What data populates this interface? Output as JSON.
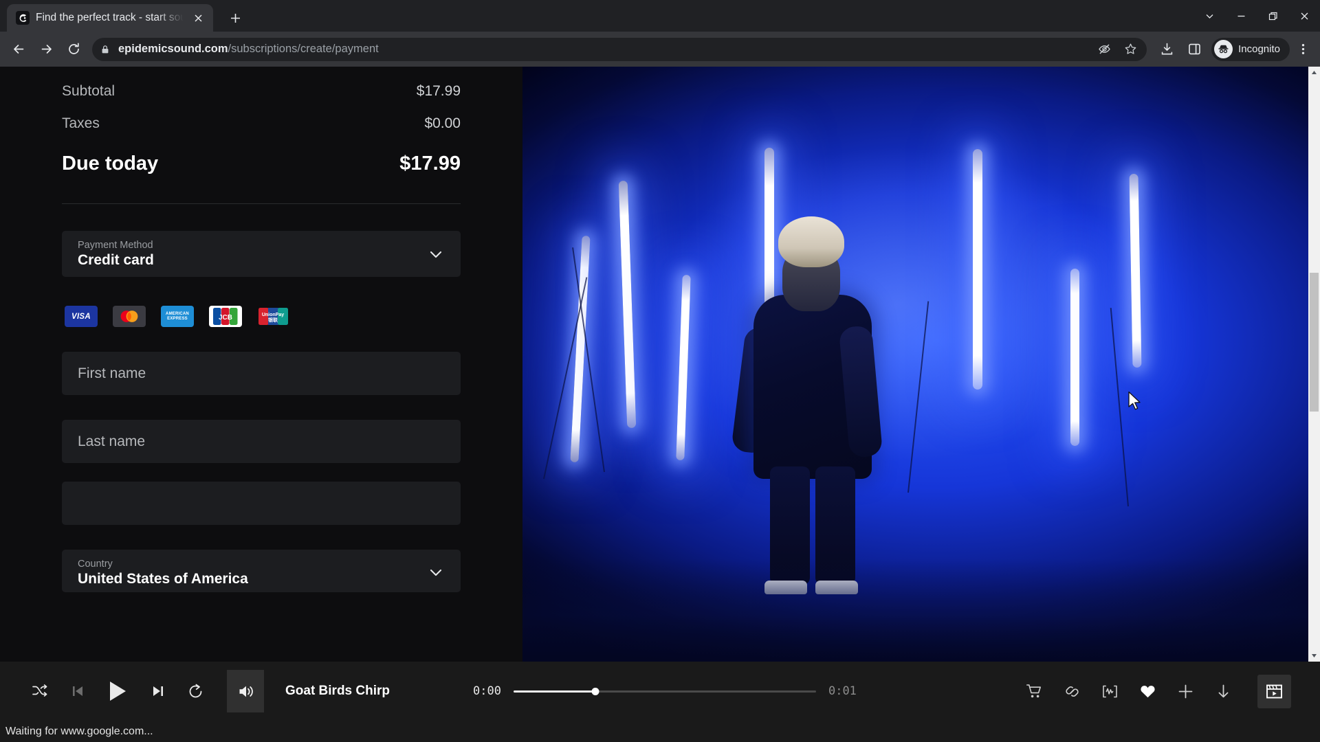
{
  "browser": {
    "tab": {
      "title": "Find the perfect track - start sou",
      "favicon_name": "epidemic-sound-favicon",
      "close_label": "✕"
    },
    "new_tab_label": "+",
    "window_controls": {
      "collapse_label": "⌄",
      "minimize_label": "—",
      "maximize_label": "❐",
      "close_label": "✕"
    },
    "toolbar": {
      "back_label": "←",
      "forward_label": "→",
      "reload_label": "↻",
      "lock_icon": "lock-icon",
      "url_domain": "epidemicsound.com",
      "url_path": "/subscriptions/create/payment",
      "tracking_protection_icon": "eye-slash-icon",
      "bookmark_icon": "star-icon",
      "download_icon": "download-icon",
      "sidepanel_icon": "side-panel-icon",
      "profile_label": "Incognito",
      "menu_icon": "three-dots-icon"
    }
  },
  "checkout": {
    "lines": [
      {
        "label": "Subtotal",
        "value": "$17.99"
      },
      {
        "label": "Taxes",
        "value": "$0.00"
      }
    ],
    "due": {
      "label": "Due today",
      "value": "$17.99"
    },
    "payment_method": {
      "label": "Payment Method",
      "value": "Credit card",
      "chevron_icon": "chevron-down-icon"
    },
    "accepted_cards": [
      {
        "name": "visa-card-icon",
        "text": "VISA"
      },
      {
        "name": "mastercard-card-icon",
        "text": ""
      },
      {
        "name": "amex-card-icon",
        "text": "AMERICAN EXPRESS"
      },
      {
        "name": "jcb-card-icon",
        "text": "JCB"
      },
      {
        "name": "unionpay-card-icon",
        "text": "UnionPay"
      }
    ],
    "fields": [
      {
        "name": "first-name-field",
        "placeholder": "First name",
        "value": ""
      },
      {
        "name": "last-name-field",
        "placeholder": "Last name",
        "value": ""
      },
      {
        "name": "address-field",
        "placeholder": "",
        "value": ""
      }
    ],
    "country": {
      "label": "Country",
      "value": "United States of America",
      "chevron_icon": "chevron-down-icon"
    }
  },
  "player": {
    "controls": {
      "shuffle_icon": "shuffle-icon",
      "previous_icon": "previous-track-icon",
      "play_icon": "play-icon",
      "next_icon": "next-track-icon",
      "repeat_icon": "repeat-icon",
      "volume_icon": "volume-icon"
    },
    "track_title": "Goat Birds Chirp",
    "time_current": "0:00",
    "time_duration": "0:01",
    "progress_percent": 27,
    "actions": [
      {
        "name": "cart-icon"
      },
      {
        "name": "link-icon"
      },
      {
        "name": "waveform-icon"
      },
      {
        "name": "heart-icon"
      },
      {
        "name": "plus-icon"
      },
      {
        "name": "download-icon"
      },
      {
        "name": "video-clip-icon"
      }
    ]
  },
  "status_bar": {
    "text": "Waiting for www.google.com..."
  },
  "scrollbar": {
    "up_arrow": "▲",
    "down_arrow": "▼"
  }
}
